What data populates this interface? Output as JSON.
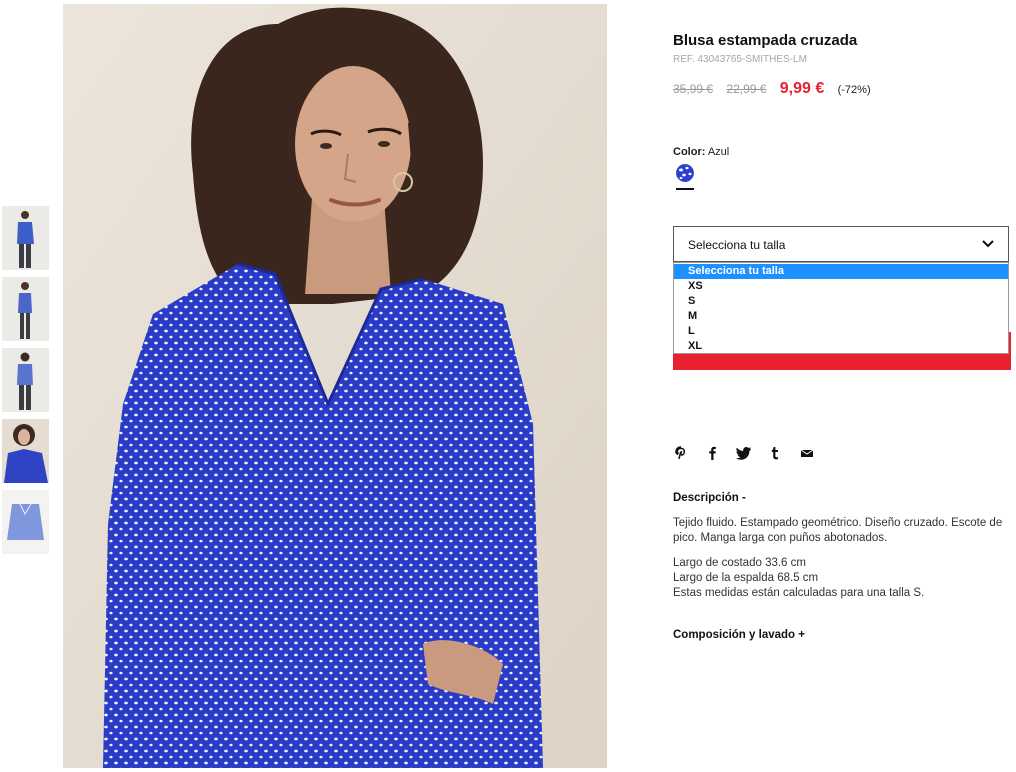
{
  "thumbnails": [
    {
      "alt": "thumb-full-front"
    },
    {
      "alt": "thumb-full-side"
    },
    {
      "alt": "thumb-full-back"
    },
    {
      "alt": "thumb-closeup"
    },
    {
      "alt": "thumb-flat"
    }
  ],
  "product": {
    "title": "Blusa estampada cruzada",
    "ref": "REF. 43043765-SMITHES-LM",
    "price_original": "35,99 €",
    "price_previous": "22,99 €",
    "price_current": "9,99 €",
    "discount": "(-72%)"
  },
  "color": {
    "label": "Color:",
    "value": "Azul",
    "swatch_color": "#2b3fd1"
  },
  "size": {
    "placeholder": "Selecciona tu talla",
    "options": [
      "Selecciona tu talla",
      "XS",
      "S",
      "M",
      "L",
      "XL"
    ],
    "highlight_color": "#1e90ff"
  },
  "add_button_color": "#e8202f",
  "share": [
    "pinterest-icon",
    "facebook-icon",
    "twitter-icon",
    "tumblr-icon",
    "email-icon"
  ],
  "description": {
    "heading": "Descripción -",
    "para1": "Tejido fluido. Estampado geométrico. Diseño cruzado. Escote de pico. Manga larga con puños abotonados.",
    "line1": "Largo de costado 33.6 cm",
    "line2": "Largo de la espalda 68.5 cm",
    "line3": "Estas medidas están calculadas para una talla S."
  },
  "composition": {
    "heading": "Composición y lavado +"
  }
}
